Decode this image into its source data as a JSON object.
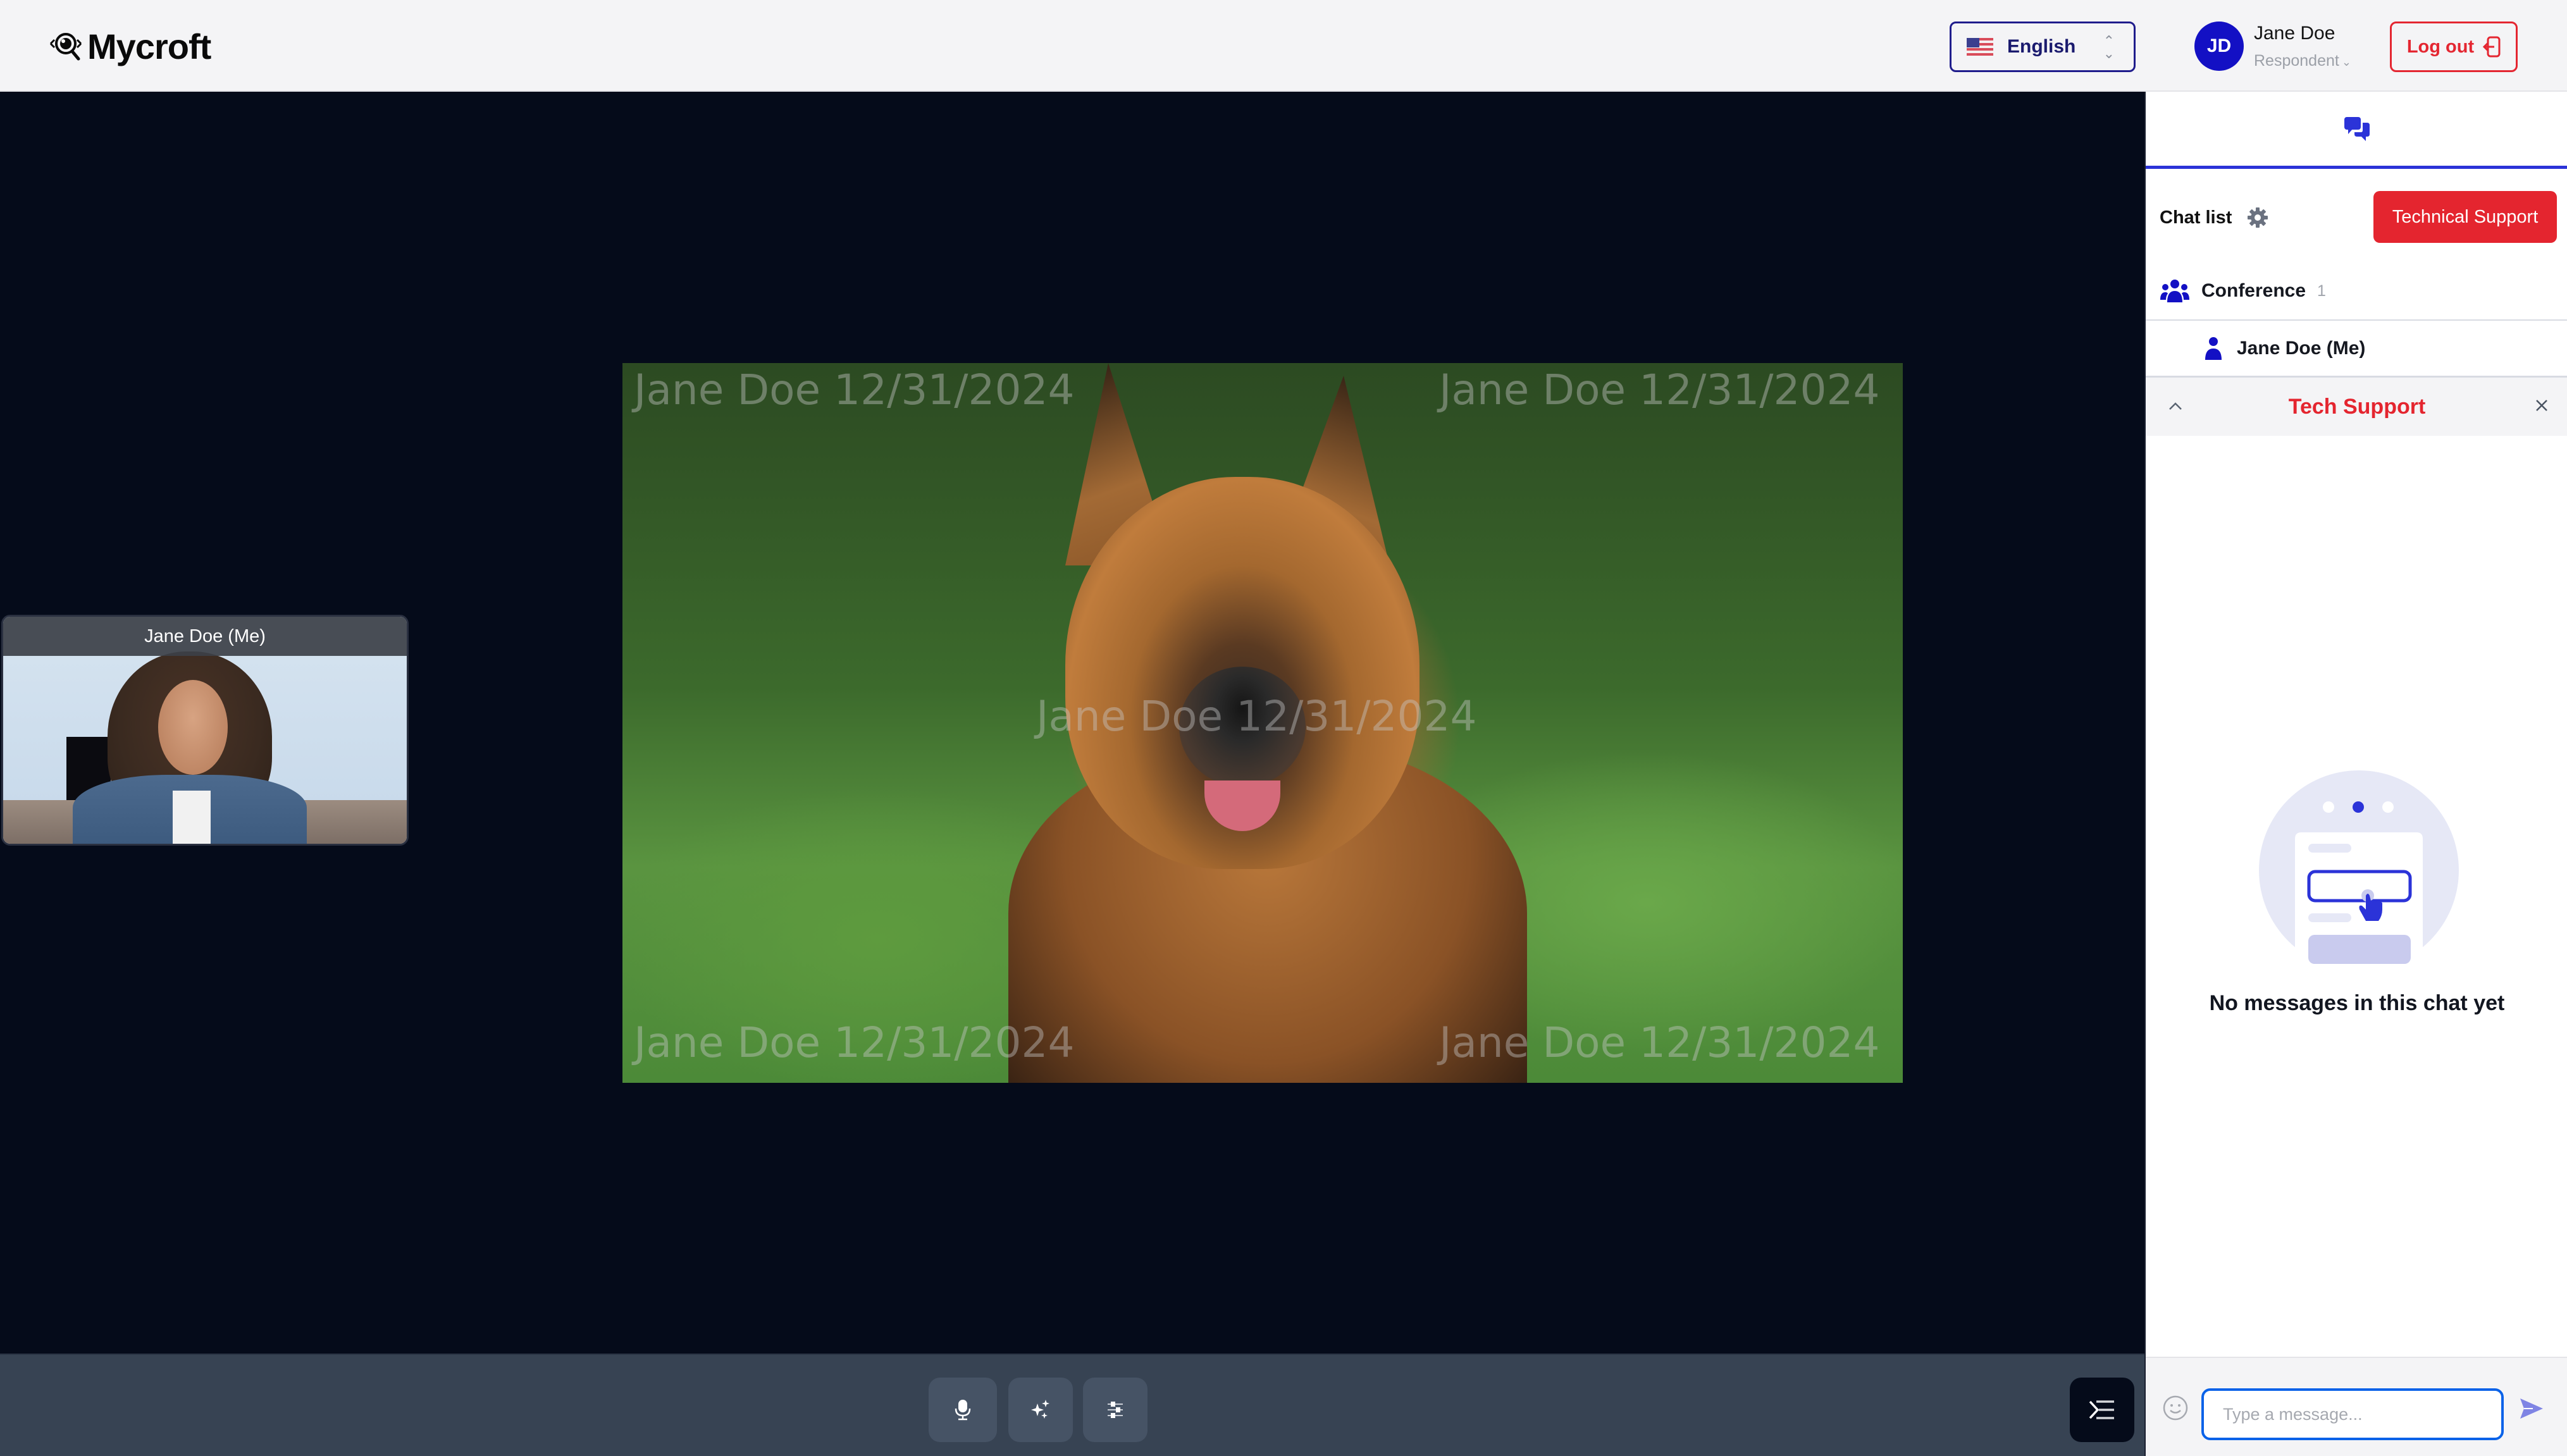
{
  "header": {
    "brand": "Mycroft",
    "language": {
      "selected": "English",
      "flag": "us-flag-icon"
    },
    "user": {
      "initials": "JD",
      "name": "Jane Doe",
      "role": "Respondent"
    },
    "logout_label": "Log out"
  },
  "stage": {
    "main_video": {
      "subject": "German Shepherd dog",
      "watermarks": [
        "Jane Doe 12/31/2024",
        "Jane Doe 12/31/2024",
        "Jane Doe 12/31/2024",
        "Jane Doe 12/31/2024",
        "Jane Doe 12/31/2024"
      ]
    },
    "self_view": {
      "label": "Jane Doe (Me)"
    }
  },
  "controls": {
    "buttons": [
      {
        "name": "microphone",
        "icon": "microphone-icon"
      },
      {
        "name": "effects",
        "icon": "sparkles-icon"
      },
      {
        "name": "settings",
        "icon": "sliders-icon"
      }
    ],
    "panel_toggle": {
      "icon": "panel-toggle-icon"
    }
  },
  "sidebar": {
    "active_tab_icon": "chat-bubbles-icon",
    "chat_list_title": "Chat list",
    "tech_support_button": "Technical Support",
    "conference": {
      "label": "Conference",
      "count": "1"
    },
    "members": [
      {
        "label": "Jane Doe (Me)"
      }
    ],
    "open_chat": {
      "title": "Tech Support",
      "empty_message": "No messages in this chat yet"
    },
    "composer": {
      "placeholder": "Type a message...",
      "value": ""
    }
  },
  "colors": {
    "brand_blue": "#1310c4",
    "accent_blue": "#2b33d8",
    "danger_red": "#e4252f",
    "stage_bg": "#050b1a",
    "controlbar_bg": "#374353"
  }
}
